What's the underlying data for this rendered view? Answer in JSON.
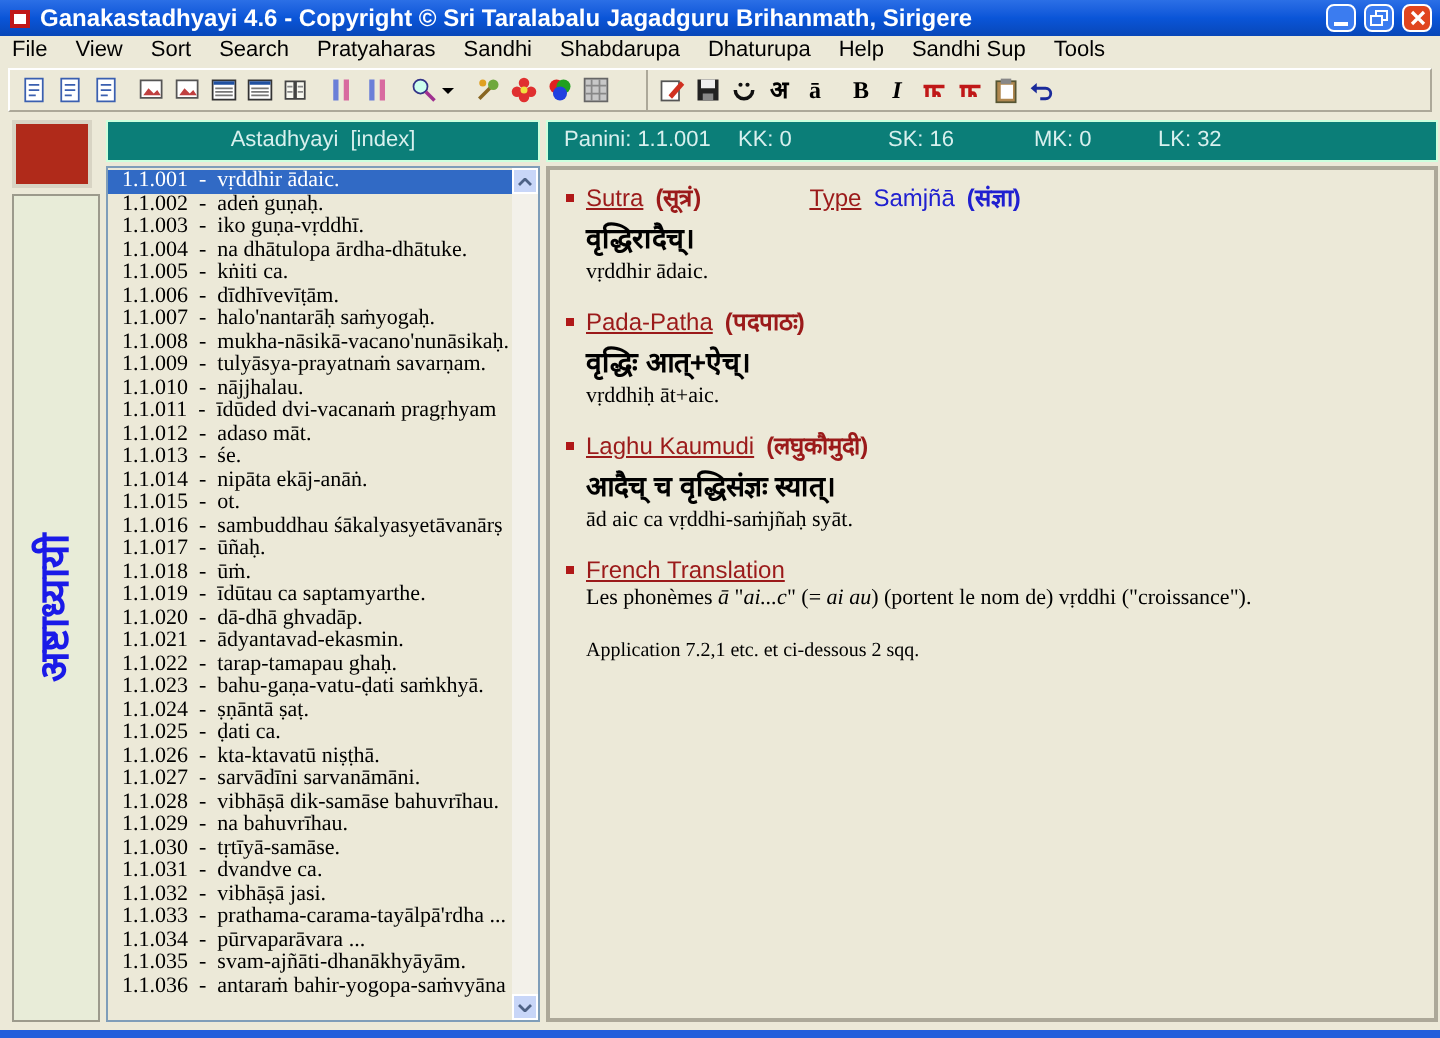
{
  "window": {
    "title": "Ganakastadhyayi 4.6 - Copyright © Sri Taralabalu Jagadguru Brihanmath, Sirigere"
  },
  "menu": [
    "File",
    "View",
    "Sort",
    "Search",
    "Pratyaharas",
    "Sandhi",
    "Shabdarupa",
    "Dhaturupa",
    "Help",
    "Sandhi Sup",
    "Tools"
  ],
  "toolbar": [
    [
      {
        "kind": "doc"
      },
      {
        "kind": "doc"
      },
      {
        "kind": "doc"
      }
    ],
    [
      {
        "kind": "image"
      },
      {
        "kind": "image"
      },
      {
        "kind": "window"
      },
      {
        "kind": "window"
      },
      {
        "kind": "book"
      }
    ],
    [
      {
        "kind": "columns"
      },
      {
        "kind": "columns"
      }
    ],
    [
      {
        "kind": "dropdown"
      }
    ],
    [
      {
        "kind": "tools"
      },
      {
        "kind": "flower"
      },
      {
        "kind": "color"
      },
      {
        "kind": "grid"
      }
    ],
    [
      {
        "kind": "edit"
      },
      {
        "kind": "save"
      },
      {
        "kind": "face"
      },
      {
        "kind": "text",
        "label": "अ"
      },
      {
        "kind": "text",
        "label": "ā"
      }
    ],
    [
      {
        "kind": "text",
        "label": "B"
      },
      {
        "kind": "text",
        "label": "I",
        "italic": true
      },
      {
        "kind": "script"
      },
      {
        "kind": "script"
      },
      {
        "kind": "clipboard"
      },
      {
        "kind": "undo"
      }
    ]
  ],
  "side_panel": {
    "label": "अष्टाध्यायी"
  },
  "index_panel": {
    "header": "Astadhyayi  [index]",
    "items": [
      {
        "label": "1.1.001  -  vṛddhir ādaic.",
        "selected": true
      },
      {
        "label": "1.1.002  -  adeṅ guṇaḥ.",
        "selected": false
      },
      {
        "label": "1.1.003  -  iko guṇa-vṛddhī.",
        "selected": false
      },
      {
        "label": "1.1.004  -  na dhātulopa ārdha-dhātuke.",
        "selected": false
      },
      {
        "label": "1.1.005  -  kṅiti ca.",
        "selected": false
      },
      {
        "label": "1.1.006  -  dīdhīvevīṭām.",
        "selected": false
      },
      {
        "label": "1.1.007  -  halo'nantarāḥ saṁyogaḥ.",
        "selected": false
      },
      {
        "label": "1.1.008  -  mukha-nāsikā-vacano'nunāsikaḥ.",
        "selected": false
      },
      {
        "label": "1.1.009  -  tulyāsya-prayatnaṁ savarṇam.",
        "selected": false
      },
      {
        "label": "1.1.010  -  nājjhalau.",
        "selected": false
      },
      {
        "label": "1.1.011  -  īdūded dvi-vacanaṁ pragṛhyam",
        "selected": false
      },
      {
        "label": "1.1.012  -  adaso māt.",
        "selected": false
      },
      {
        "label": "1.1.013  -  śe.",
        "selected": false
      },
      {
        "label": "1.1.014  -  nipāta ekāj-anāṅ.",
        "selected": false
      },
      {
        "label": "1.1.015  -  ot.",
        "selected": false
      },
      {
        "label": "1.1.016  -  sambuddhau śākalyasyetāvanārṣ",
        "selected": false
      },
      {
        "label": "1.1.017  -  ūñaḥ.",
        "selected": false
      },
      {
        "label": "1.1.018  -  ūṁ.",
        "selected": false
      },
      {
        "label": "1.1.019  -  īdūtau ca saptamyarthe.",
        "selected": false
      },
      {
        "label": "1.1.020  -  dā-dhā ghvadāp.",
        "selected": false
      },
      {
        "label": "1.1.021  -  ādyantavad-ekasmin.",
        "selected": false
      },
      {
        "label": "1.1.022  -  tarap-tamapau ghaḥ.",
        "selected": false
      },
      {
        "label": "1.1.023  -  bahu-gaṇa-vatu-ḍati saṁkhyā.",
        "selected": false
      },
      {
        "label": "1.1.024  -  ṣṇāntā ṣaṭ.",
        "selected": false
      },
      {
        "label": "1.1.025  -  ḍati ca.",
        "selected": false
      },
      {
        "label": "1.1.026  -  kta-ktavatū niṣṭhā.",
        "selected": false
      },
      {
        "label": "1.1.027  -  sarvādīni sarvanāmāni.",
        "selected": false
      },
      {
        "label": "1.1.028  -  vibhāṣā dik-samāse bahuvrīhau.",
        "selected": false
      },
      {
        "label": "1.1.029  -  na bahuvrīhau.",
        "selected": false
      },
      {
        "label": "1.1.030  -  tṛtīyā-samāse.",
        "selected": false
      },
      {
        "label": "1.1.031  -  dvandve ca.",
        "selected": false
      },
      {
        "label": "1.1.032  -  vibhāṣā jasi.",
        "selected": false
      },
      {
        "label": "1.1.033  -  prathama-carama-tayālpā'rdha ...",
        "selected": false
      },
      {
        "label": "1.1.034  -  pūrvaparāvara ...",
        "selected": false
      },
      {
        "label": "1.1.035  -  svam-ajñāti-dhanākhyāyām.",
        "selected": false
      },
      {
        "label": "1.1.036  -  antaraṁ bahir-yogopa-saṁvyāna",
        "selected": false
      }
    ]
  },
  "detail_panel": {
    "header": [
      "Panini: 1.1.001",
      "KK: 0",
      "SK: 16",
      "MK: 0",
      "LK: 32"
    ],
    "sections": [
      {
        "title": "Sutra",
        "title_devanagari": "(सूत्रं)",
        "type_label": "Type",
        "type_value": "Saṁjñā",
        "type_devanagari": "(संज्ञा)",
        "devanagari": "वृद्धिरादैच्।",
        "roman": "vṛddhir ādaic."
      },
      {
        "title": "Pada-Patha",
        "title_devanagari": "(पदपाठः)",
        "devanagari": "वृद्धिः आत्+ऐच्।",
        "roman": "vṛddhiḥ āt+aic."
      },
      {
        "title": "Laghu Kaumudi",
        "title_devanagari": "(लघुकौमुदी)",
        "devanagari": "आदैच् च वृद्धिसंज्ञः स्यात्।",
        "roman": "ād aic ca vṛddhi-saṁjñaḥ syāt."
      },
      {
        "title": "French Translation",
        "translation": "Les phonèmes *ā*  \"*ai...c*\" (= *ai au*) (portent le nom de) vṛddhi (\"croissance\").",
        "note": "Application 7.2,1 etc. et ci-dessous 2 sqq."
      }
    ]
  }
}
